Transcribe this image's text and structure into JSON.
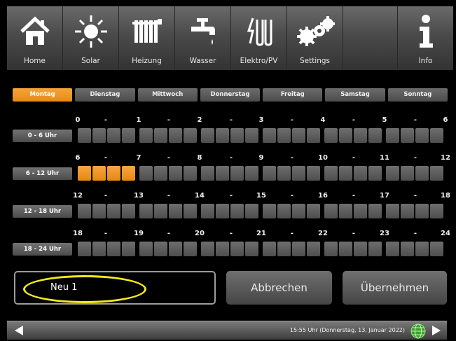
{
  "nav": {
    "items": [
      {
        "label": "Home",
        "icon": "house-icon"
      },
      {
        "label": "Solar",
        "icon": "sun-icon"
      },
      {
        "label": "Heizung",
        "icon": "radiator-icon"
      },
      {
        "label": "Wasser",
        "icon": "tap-icon"
      },
      {
        "label": "Elektro/PV",
        "icon": "heating-rod-icon"
      },
      {
        "label": "Settings",
        "icon": "gears-icon"
      },
      {
        "label": "",
        "icon": ""
      },
      {
        "label": "Info",
        "icon": "info-icon"
      }
    ]
  },
  "days": {
    "active": "Montag",
    "items": [
      "Montag",
      "Dienstag",
      "Mittwoch",
      "Donnerstag",
      "Freitag",
      "Samstag",
      "Sonntag"
    ]
  },
  "schedule": {
    "blocks": [
      {
        "label": "0 - 6 Uhr",
        "hours": [
          "0",
          "-",
          "1",
          "-",
          "2",
          "-",
          "3",
          "-",
          "4",
          "-",
          "5",
          "-",
          "6"
        ],
        "slots_on": []
      },
      {
        "label": "6 - 12 Uhr",
        "hours": [
          "6",
          "-",
          "7",
          "-",
          "8",
          "-",
          "9",
          "-",
          "10",
          "-",
          "11",
          "-",
          "12"
        ],
        "slots_on": [
          0,
          1,
          2,
          3
        ]
      },
      {
        "label": "12 - 18 Uhr",
        "hours": [
          "12",
          "-",
          "13",
          "-",
          "14",
          "-",
          "15",
          "-",
          "16",
          "-",
          "17",
          "-",
          "18"
        ],
        "slots_on": []
      },
      {
        "label": "18 - 24 Uhr",
        "hours": [
          "18",
          "-",
          "19",
          "-",
          "20",
          "-",
          "21",
          "-",
          "22",
          "-",
          "23",
          "-",
          "24"
        ],
        "slots_on": []
      }
    ]
  },
  "form": {
    "name_value": "Neu 1",
    "cancel_label": "Abbrechen",
    "apply_label": "Übernehmen"
  },
  "status": {
    "text": "15:55 Uhr (Donnerstag, 13. Januar 2022)"
  },
  "colors": {
    "accent": "#f0961e",
    "highlight": "#f4ea1c",
    "button": "#5a5a5a"
  }
}
